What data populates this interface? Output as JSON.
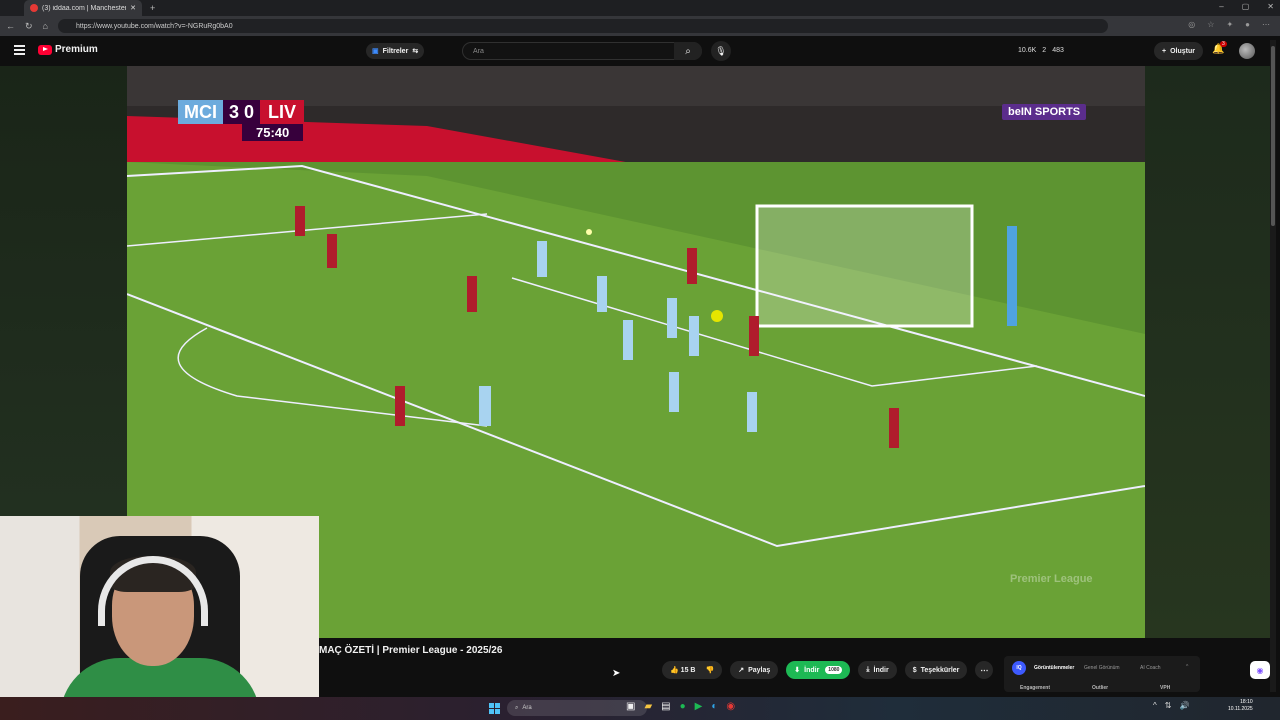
{
  "browser": {
    "tab_title": "(3) iddaa.com | Manchester C...",
    "url": "https://www.youtube.com/watch?v=-NGRuRg0bA0",
    "window_controls": [
      "–",
      "▢",
      "✕"
    ]
  },
  "youtube_header": {
    "logo_text": "Premium",
    "filters_label": "Filtreler",
    "search_placeholder": "Ara",
    "stats": [
      "10.6K",
      "2",
      "483"
    ],
    "create_label": "Oluştur",
    "notification_count": "3"
  },
  "video": {
    "scoreboard": {
      "home": "MCI",
      "score": "3 0",
      "away": "LIV",
      "clock": "75:40"
    },
    "broadcaster": "beIN SPORTS",
    "watermark": "Premier League"
  },
  "video_info": {
    "title": "MAÇ ÖZETİ | Premier League - 2025/26",
    "like_count": "15 B",
    "share_label": "Paylaş",
    "download_label": "İndir",
    "quality_label": "1080",
    "download2_label": "İndir",
    "thanks_label": "Teşekkürler"
  },
  "extension_panel": {
    "tabs": [
      "Görüntülenmeler",
      "Genel Görünüm",
      "AI Coach"
    ],
    "subtabs": [
      "Engagement",
      "Outlier",
      "VPH"
    ]
  },
  "taskbar": {
    "search_placeholder": "Ara",
    "time": "18:10",
    "date": "10.11.2025"
  },
  "colors": {
    "youtube_red": "#ff0033",
    "city_blue": "#6cabdd",
    "liverpool_red": "#c8102e",
    "pl_purple": "#37003c",
    "download_green": "#1db954"
  }
}
